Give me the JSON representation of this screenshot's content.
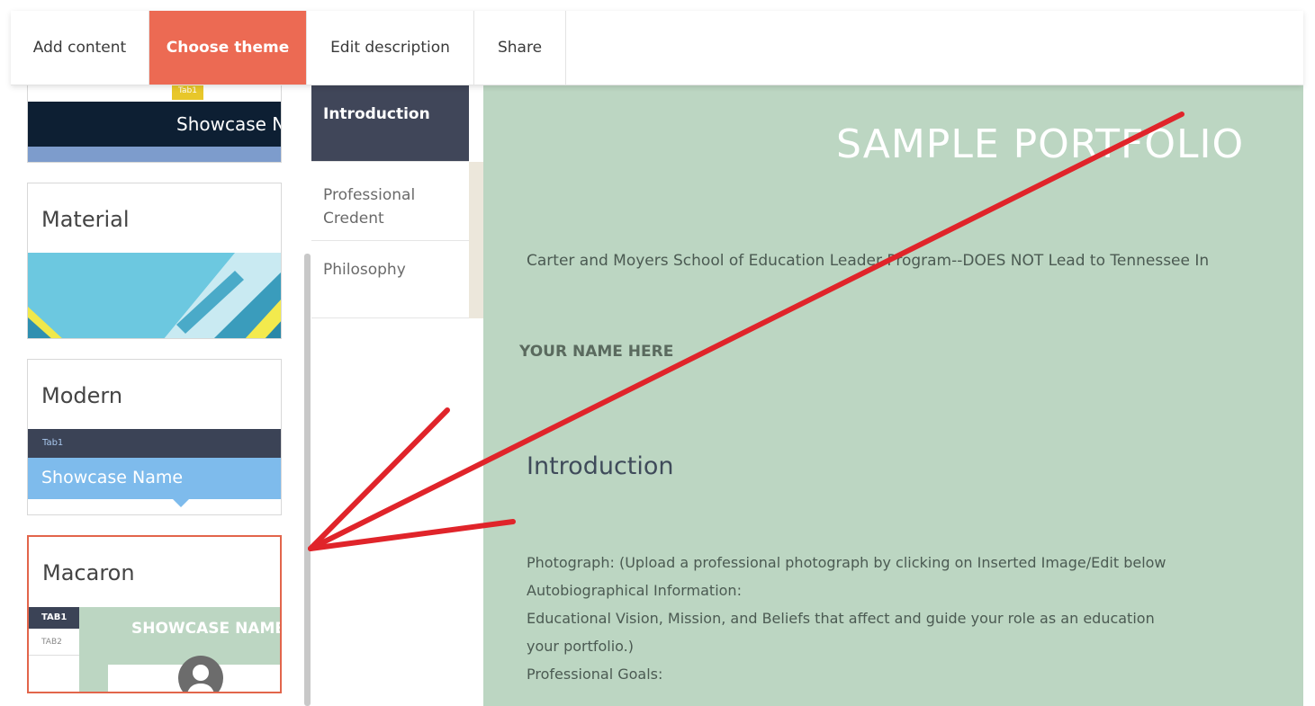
{
  "toolbar": {
    "tabs": [
      {
        "label": "Add content",
        "active": false
      },
      {
        "label": "Choose theme",
        "active": true
      },
      {
        "label": "Edit description",
        "active": false
      },
      {
        "label": "Share",
        "active": false
      }
    ]
  },
  "themes": {
    "top_partial": {
      "tab_label": "Tab1",
      "showcase_label": "Showcase Na"
    },
    "material": {
      "title": "Material"
    },
    "modern": {
      "title": "Modern",
      "tab_label": "Tab1",
      "showcase_label": "Showcase Name"
    },
    "macaron": {
      "title": "Macaron",
      "tab1": "TAB1",
      "tab2": "TAB2",
      "showcase_label": "SHOWCASE NAME",
      "selected": true
    }
  },
  "preview_nav": {
    "items": [
      {
        "label": "Introduction",
        "active": true
      },
      {
        "label": "Professional Credent",
        "active": false
      },
      {
        "label": "Philosophy",
        "active": false
      }
    ]
  },
  "content": {
    "title": "SAMPLE PORTFOLIO",
    "subtitle": "Carter and Moyers School of Education Leader Program--DOES NOT Lead to Tennessee In",
    "name_placeholder": "YOUR NAME HERE",
    "section_heading": "Introduction",
    "body_lines": [
      "Photograph: (Upload a professional photograph by clicking on Inserted Image/Edit below",
      "Autobiographical Information:",
      "Educational Vision, Mission, and Beliefs that affect and guide your role as an education",
      "your portfolio.)",
      "Professional Goals:"
    ]
  },
  "colors": {
    "accent": "#ec6a53",
    "content_bg": "#bcd6c2",
    "nav_active": "#404659",
    "annotation": "#e0242a"
  }
}
